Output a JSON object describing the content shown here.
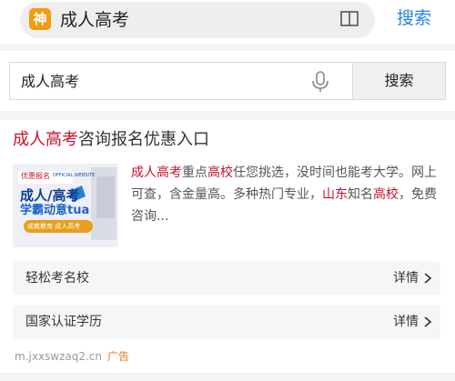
{
  "topbar": {
    "app_icon_char": "神",
    "address_text": "成人高考",
    "search_label": "搜索"
  },
  "search": {
    "value": "成人高考",
    "button_label": "搜索"
  },
  "ad": {
    "title_highlight": "成人高考",
    "title_rest": "咨询报名优惠入口",
    "thumb": {
      "top_text": "优惠报名",
      "brand_small": "OFFICIAL WEBSITE",
      "line1": "成人/高考",
      "line2": "学霸动意tua",
      "bottom_text": "成教教育·成人高考"
    },
    "desc": {
      "hl1": "成人高考",
      "t1": "重点",
      "hl2": "高校",
      "t2": "任您挑选，没时间也能考大学。网上可查，含金量高。多种热门专业，",
      "hl3": "山东",
      "t3": "知名",
      "hl4": "高校",
      "t4": "，免费咨询..."
    },
    "links": [
      {
        "label": "轻松考名校",
        "more": "详情"
      },
      {
        "label": "国家认证学历",
        "more": "详情"
      }
    ],
    "domain": "m.jxxswzaq2.cn",
    "tag": "广告"
  },
  "colors": {
    "accent_blue": "#2a82e4",
    "highlight_red": "#c8102e",
    "ad_tag_orange": "#e67e22",
    "app_icon_orange": "#f39c12"
  }
}
